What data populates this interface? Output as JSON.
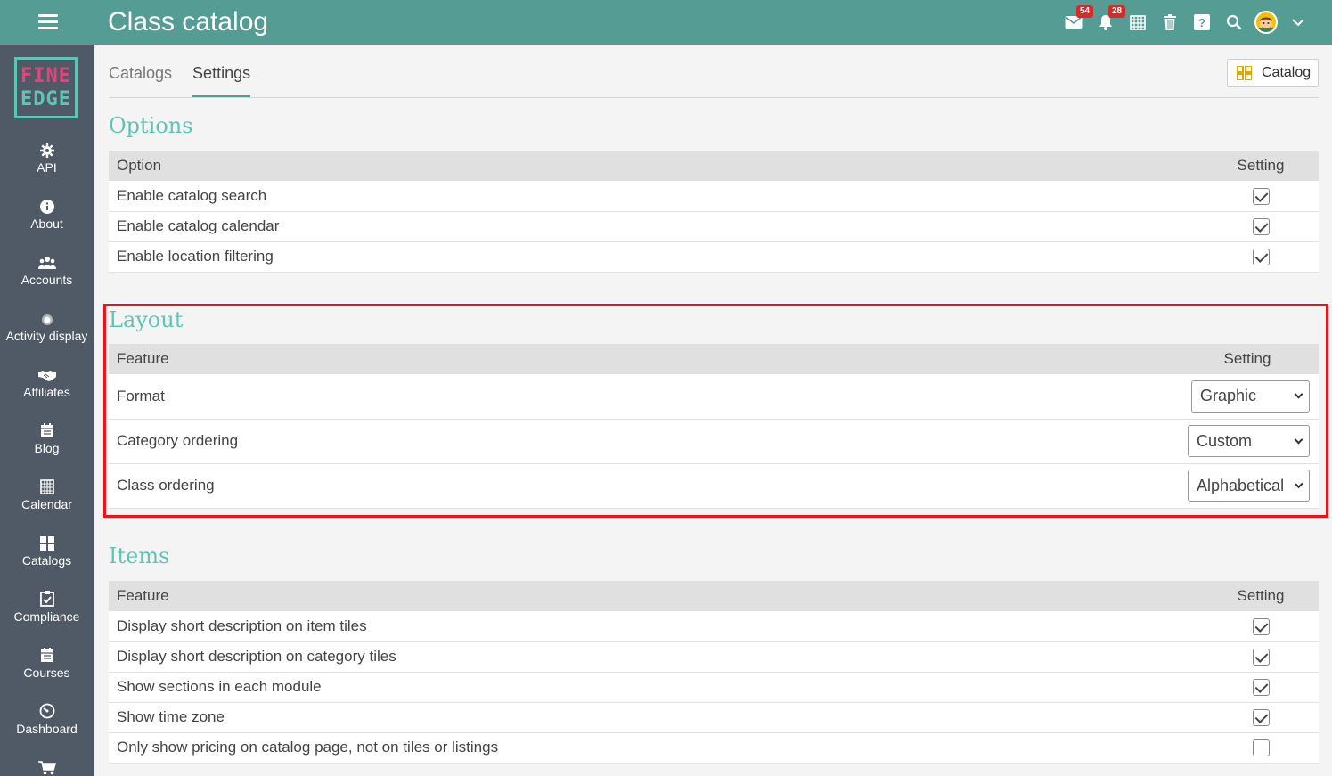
{
  "header": {
    "title": "Class catalog",
    "messages_badge": "54",
    "notifications_badge": "28"
  },
  "sidebar": {
    "logo_line1": "FINE",
    "logo_line2": "EDGE",
    "items": [
      {
        "label": "API",
        "icon": "gear-icon"
      },
      {
        "label": "About",
        "icon": "info-icon"
      },
      {
        "label": "Accounts",
        "icon": "users-icon"
      },
      {
        "label": "Activity display",
        "icon": "dot-icon"
      },
      {
        "label": "Affiliates",
        "icon": "handshake-icon"
      },
      {
        "label": "Blog",
        "icon": "blog-icon"
      },
      {
        "label": "Calendar",
        "icon": "calendar-icon"
      },
      {
        "label": "Catalogs",
        "icon": "grid-icon"
      },
      {
        "label": "Compliance",
        "icon": "clipboard-icon"
      },
      {
        "label": "Courses",
        "icon": "courses-icon"
      },
      {
        "label": "Dashboard",
        "icon": "dashboard-icon"
      },
      {
        "label": "",
        "icon": "cart-icon"
      }
    ]
  },
  "tabs": [
    {
      "label": "Catalogs",
      "active": false
    },
    {
      "label": "Settings",
      "active": true
    }
  ],
  "catalog_button": "Catalog",
  "options": {
    "title": "Options",
    "col_option": "Option",
    "col_setting": "Setting",
    "rows": [
      {
        "label": "Enable catalog search",
        "checked": true
      },
      {
        "label": "Enable catalog calendar",
        "checked": true
      },
      {
        "label": "Enable location filtering",
        "checked": true
      }
    ]
  },
  "layout": {
    "title": "Layout",
    "col_feature": "Feature",
    "col_setting": "Setting",
    "rows": [
      {
        "label": "Format",
        "value": "Graphic"
      },
      {
        "label": "Category ordering",
        "value": "Custom"
      },
      {
        "label": "Class ordering",
        "value": "Alphabetical"
      }
    ]
  },
  "items": {
    "title": "Items",
    "col_feature": "Feature",
    "col_setting": "Setting",
    "rows": [
      {
        "label": "Display short description on item tiles",
        "checked": true
      },
      {
        "label": "Display short description on category tiles",
        "checked": true
      },
      {
        "label": "Show sections in each module",
        "checked": true
      },
      {
        "label": "Show time zone",
        "checked": true
      },
      {
        "label": "Only show pricing on catalog page, not on tiles or listings",
        "checked": false
      }
    ]
  },
  "colors": {
    "topbar": "#559c94",
    "sidebar": "#4f5a66",
    "accent": "#5ec4b6",
    "highlight": "#e8141e"
  }
}
